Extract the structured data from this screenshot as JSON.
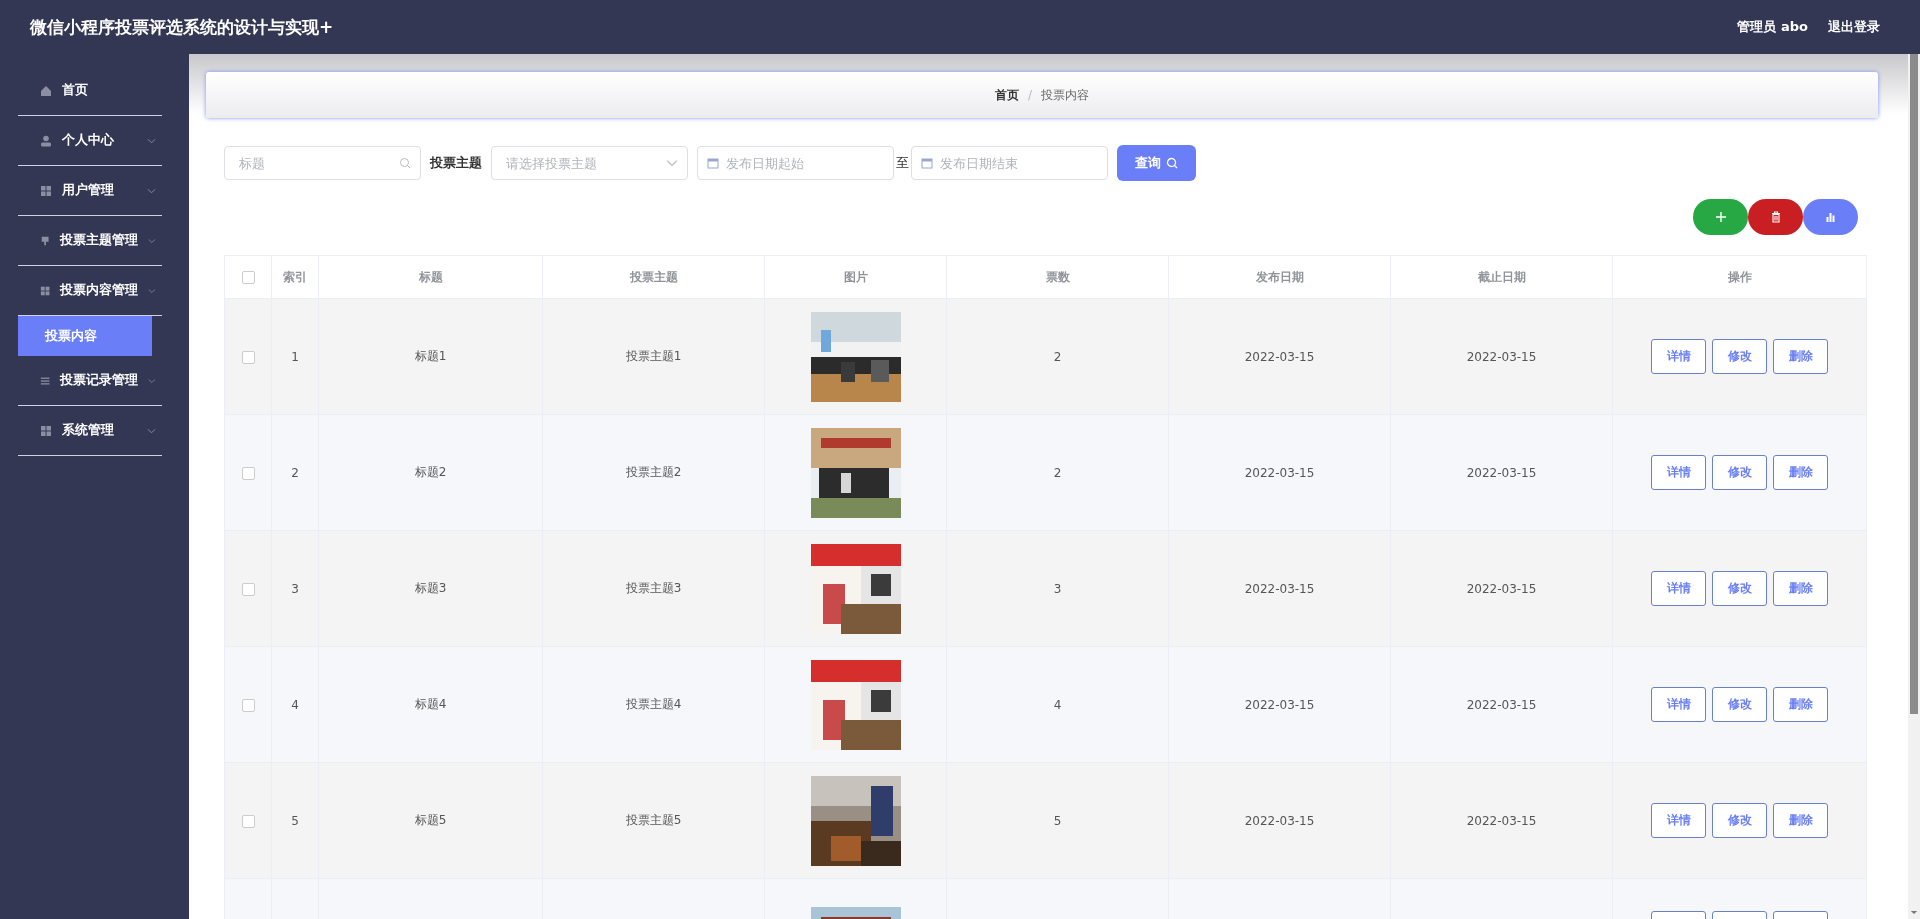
{
  "header": {
    "title": "微信小程序投票评选系统的设计与实现+",
    "user": "管理员 abo",
    "logout": "退出登录"
  },
  "sidebar": {
    "items": [
      {
        "label": "首页",
        "kind": "home",
        "expandable": false
      },
      {
        "label": "个人中心",
        "kind": "user",
        "expandable": true
      },
      {
        "label": "用户管理",
        "kind": "grid",
        "expandable": true
      },
      {
        "label": "投票主题管理",
        "kind": "pin",
        "expandable": true
      },
      {
        "label": "投票内容管理",
        "kind": "grid",
        "expandable": true,
        "children": [
          {
            "label": "投票内容",
            "selected": true
          }
        ]
      },
      {
        "label": "投票记录管理",
        "kind": "list",
        "expandable": true
      },
      {
        "label": "系统管理",
        "kind": "grid",
        "expandable": true
      }
    ]
  },
  "breadcrumb": {
    "items": [
      "首页",
      "投票内容"
    ],
    "separator": "/"
  },
  "search": {
    "title_placeholder": "标题",
    "topic_label": "投票主题",
    "topic_placeholder": "请选择投票主题",
    "start_placeholder": "发布日期起始",
    "range_separator": "至",
    "end_placeholder": "发布日期结束",
    "query_button": "查询"
  },
  "actions": [
    {
      "kind": "add"
    },
    {
      "kind": "delete"
    },
    {
      "kind": "chart"
    }
  ],
  "table": {
    "all_checked": false,
    "columns": [
      "索引",
      "标题",
      "投票主题",
      "图片",
      "票数",
      "发布日期",
      "截止日期",
      "操作"
    ],
    "rows": [
      {
        "kind": "full",
        "checked": false,
        "index": "1",
        "title": "标题1",
        "topic": "投票主题1",
        "votes": "2",
        "publish_date": "2022-03-15",
        "deadline": "2022-03-15",
        "buttons": [
          "详情",
          "修改",
          "删除"
        ]
      },
      {
        "kind": "full",
        "checked": false,
        "index": "2",
        "title": "标题2",
        "topic": "投票主题2",
        "votes": "2",
        "publish_date": "2022-03-15",
        "deadline": "2022-03-15",
        "buttons": [
          "详情",
          "修改",
          "删除"
        ]
      },
      {
        "kind": "full",
        "checked": false,
        "index": "3",
        "title": "标题3",
        "topic": "投票主题3",
        "votes": "3",
        "publish_date": "2022-03-15",
        "deadline": "2022-03-15",
        "buttons": [
          "详情",
          "修改",
          "删除"
        ]
      },
      {
        "kind": "full",
        "checked": false,
        "index": "4",
        "title": "标题4",
        "topic": "投票主题4",
        "votes": "4",
        "publish_date": "2022-03-15",
        "deadline": "2022-03-15",
        "buttons": [
          "详情",
          "修改",
          "删除"
        ]
      },
      {
        "kind": "full",
        "checked": false,
        "index": "5",
        "title": "标题5",
        "topic": "投票主题5",
        "votes": "5",
        "publish_date": "2022-03-15",
        "deadline": "2022-03-15",
        "buttons": [
          "详情",
          "修改",
          "删除"
        ]
      },
      {
        "kind": "partial"
      }
    ]
  }
}
